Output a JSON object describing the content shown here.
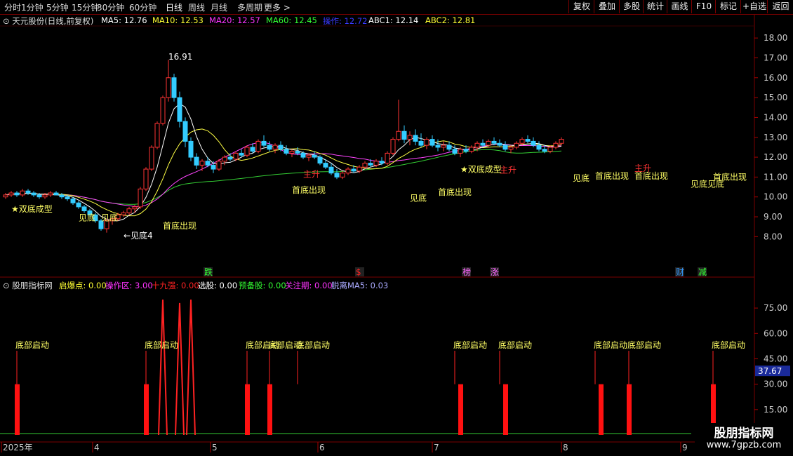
{
  "toolbar": {
    "periods": [
      "分时",
      "1分钟",
      "5分钟",
      "15分钟",
      "30分钟",
      "60分钟",
      "日线",
      "周线",
      "月线",
      "多周期",
      "更多 >"
    ],
    "active_period": "日线",
    "buttons": [
      "复权",
      "叠加",
      "多股",
      "统计",
      "画线",
      "F10",
      "标记",
      "+自选",
      "返回"
    ]
  },
  "main_header": {
    "stock_title": "天元股份(日线,前复权)",
    "indicators": [
      {
        "name": "MA5",
        "value": "12.76",
        "color": "#ffffff"
      },
      {
        "name": "MA10",
        "value": "12.53",
        "color": "#ffff33"
      },
      {
        "name": "MA20",
        "value": "12.57",
        "color": "#ff33ff"
      },
      {
        "name": "MA60",
        "value": "12.45",
        "color": "#33ff33"
      },
      {
        "name": "操作",
        "value": "12.72",
        "color": "#3a3aff"
      },
      {
        "name": "ABC1",
        "value": "12.14",
        "color": "#ffffff"
      },
      {
        "name": "ABC2",
        "value": "12.81",
        "color": "#ffff33"
      }
    ]
  },
  "sub_header": {
    "title": "股朋指标网",
    "indicators": [
      {
        "name": "启爆点",
        "value": "0.00",
        "color": "#ffff33"
      },
      {
        "name": "操作区",
        "value": "3.00",
        "color": "#ff33ff"
      },
      {
        "name": "十九强",
        "value": "0.00",
        "color": "#ff2222"
      },
      {
        "name": "选股",
        "value": "0.00",
        "color": "#ffffff"
      },
      {
        "name": "预备股",
        "value": "0.00",
        "color": "#33ff33"
      },
      {
        "name": "关注期",
        "value": "0.00",
        "color": "#ff33ff"
      },
      {
        "name": "脱离MA5",
        "value": "0.03",
        "color": "#aaaaff"
      }
    ]
  },
  "axis": {
    "price_ticks": [
      "18.00",
      "17.00",
      "16.00",
      "15.00",
      "14.00",
      "13.00",
      "12.00",
      "11.00",
      "10.00",
      "9.00",
      "8.00"
    ],
    "sub_ticks": [
      "75.00",
      "60.00",
      "45.00",
      "30.00",
      "15.00"
    ],
    "sub_current": "37.67",
    "x_labels": [
      "2025年",
      "4",
      "5",
      "6",
      "7",
      "8",
      "9"
    ],
    "price_range": [
      7.2,
      18.5
    ],
    "sub_range": [
      0,
      85
    ]
  },
  "chart_data": {
    "type": "candlestick",
    "series": [
      {
        "values": [
          [
            10.0,
            10.2,
            9.9,
            10.1
          ],
          [
            10.1,
            10.3,
            10.0,
            10.2
          ],
          [
            10.2,
            10.3,
            10.0,
            10.1
          ],
          [
            10.1,
            10.4,
            10.0,
            10.3
          ],
          [
            10.3,
            10.4,
            10.1,
            10.2
          ],
          [
            10.2,
            10.3,
            10.0,
            10.1
          ],
          [
            10.1,
            10.2,
            9.9,
            10.0
          ],
          [
            10.0,
            10.2,
            9.9,
            10.1
          ],
          [
            10.1,
            10.3,
            10.0,
            10.2
          ],
          [
            10.2,
            10.3,
            10.1,
            10.1
          ],
          [
            10.1,
            10.2,
            9.9,
            10.0
          ],
          [
            10.0,
            10.1,
            9.8,
            9.9
          ],
          [
            9.9,
            10.0,
            9.6,
            9.7
          ],
          [
            9.7,
            9.8,
            9.4,
            9.5
          ],
          [
            9.5,
            9.6,
            9.2,
            9.3
          ],
          [
            9.3,
            9.4,
            9.0,
            9.1
          ],
          [
            9.1,
            9.2,
            8.7,
            8.8
          ],
          [
            8.8,
            8.9,
            8.3,
            8.4
          ],
          [
            8.4,
            8.9,
            8.2,
            8.8
          ],
          [
            8.8,
            9.0,
            8.6,
            8.9
          ],
          [
            8.9,
            9.2,
            8.8,
            9.1
          ],
          [
            9.1,
            9.3,
            9.0,
            9.2
          ],
          [
            9.2,
            9.5,
            9.1,
            9.4
          ],
          [
            9.4,
            9.6,
            9.2,
            9.5
          ],
          [
            9.5,
            10.5,
            9.4,
            10.4
          ],
          [
            10.4,
            11.5,
            10.3,
            11.4
          ],
          [
            11.4,
            12.6,
            11.3,
            12.5
          ],
          [
            12.5,
            13.8,
            12.4,
            13.7
          ],
          [
            13.7,
            15.1,
            13.6,
            15.0
          ],
          [
            15.0,
            16.9,
            14.8,
            16.0
          ],
          [
            16.0,
            16.2,
            14.8,
            15.0
          ],
          [
            15.0,
            15.3,
            13.5,
            13.8
          ],
          [
            13.8,
            14.0,
            12.5,
            12.8
          ],
          [
            12.8,
            13.0,
            11.8,
            12.0
          ],
          [
            12.0,
            12.2,
            11.4,
            11.6
          ],
          [
            11.6,
            11.9,
            11.3,
            11.8
          ],
          [
            11.8,
            12.0,
            11.5,
            11.6
          ],
          [
            11.6,
            11.8,
            11.2,
            11.4
          ],
          [
            11.4,
            11.9,
            11.3,
            11.8
          ],
          [
            11.8,
            12.1,
            11.6,
            12.0
          ],
          [
            12.0,
            12.2,
            11.8,
            11.9
          ],
          [
            11.9,
            12.3,
            11.8,
            12.2
          ],
          [
            12.2,
            12.4,
            12.0,
            12.1
          ],
          [
            12.1,
            12.6,
            12.0,
            12.5
          ],
          [
            12.5,
            12.7,
            12.2,
            12.3
          ],
          [
            12.3,
            12.9,
            12.2,
            12.8
          ],
          [
            12.8,
            13.1,
            12.5,
            12.6
          ],
          [
            12.6,
            12.8,
            12.3,
            12.4
          ],
          [
            12.4,
            12.7,
            12.2,
            12.6
          ],
          [
            12.6,
            12.8,
            12.3,
            12.4
          ],
          [
            12.4,
            12.6,
            12.1,
            12.2
          ],
          [
            12.2,
            12.4,
            12.0,
            12.3
          ],
          [
            12.3,
            12.5,
            12.1,
            12.2
          ],
          [
            12.2,
            12.3,
            11.9,
            12.0
          ],
          [
            12.0,
            12.2,
            11.8,
            12.1
          ],
          [
            12.1,
            12.3,
            11.9,
            12.0
          ],
          [
            12.0,
            12.1,
            11.6,
            11.7
          ],
          [
            11.7,
            11.9,
            11.4,
            11.5
          ],
          [
            11.5,
            11.7,
            11.1,
            11.2
          ],
          [
            11.2,
            11.4,
            10.9,
            11.0
          ],
          [
            11.0,
            11.3,
            10.9,
            11.2
          ],
          [
            11.2,
            11.5,
            11.1,
            11.4
          ],
          [
            11.4,
            11.6,
            11.2,
            11.3
          ],
          [
            11.3,
            11.6,
            11.2,
            11.5
          ],
          [
            11.5,
            11.8,
            11.4,
            11.7
          ],
          [
            11.7,
            11.9,
            11.5,
            11.6
          ],
          [
            11.6,
            11.9,
            11.5,
            11.8
          ],
          [
            11.8,
            12.0,
            11.6,
            11.7
          ],
          [
            11.7,
            12.3,
            11.6,
            12.2
          ],
          [
            12.2,
            13.0,
            12.1,
            12.9
          ],
          [
            12.9,
            14.9,
            12.8,
            13.3
          ],
          [
            13.3,
            13.6,
            12.7,
            12.9
          ],
          [
            12.9,
            13.3,
            12.6,
            13.1
          ],
          [
            13.1,
            13.4,
            12.6,
            12.8
          ],
          [
            12.8,
            13.2,
            12.5,
            12.6
          ],
          [
            12.6,
            13.0,
            12.4,
            12.9
          ],
          [
            12.9,
            13.1,
            12.5,
            12.6
          ],
          [
            12.6,
            12.9,
            12.3,
            12.5
          ],
          [
            12.5,
            12.8,
            12.3,
            12.6
          ],
          [
            12.6,
            12.8,
            12.3,
            12.4
          ],
          [
            12.4,
            12.6,
            12.1,
            12.2
          ],
          [
            12.2,
            12.5,
            12.0,
            12.4
          ],
          [
            12.4,
            12.6,
            12.2,
            12.3
          ],
          [
            12.3,
            12.6,
            12.2,
            12.5
          ],
          [
            12.5,
            12.8,
            12.3,
            12.7
          ],
          [
            12.7,
            12.9,
            12.5,
            12.6
          ],
          [
            12.6,
            12.9,
            12.5,
            12.8
          ],
          [
            12.8,
            13.0,
            12.6,
            12.7
          ],
          [
            12.7,
            12.9,
            12.5,
            12.6
          ],
          [
            12.6,
            12.8,
            12.3,
            12.4
          ],
          [
            12.4,
            12.6,
            12.2,
            12.5
          ],
          [
            12.5,
            12.8,
            12.4,
            12.7
          ],
          [
            12.7,
            13.0,
            12.6,
            12.9
          ],
          [
            12.9,
            13.1,
            12.7,
            12.8
          ],
          [
            12.8,
            13.0,
            12.5,
            12.6
          ],
          [
            12.6,
            12.8,
            12.3,
            12.4
          ],
          [
            12.4,
            12.6,
            12.2,
            12.3
          ],
          [
            12.3,
            12.6,
            12.2,
            12.5
          ],
          [
            12.5,
            12.8,
            12.4,
            12.7
          ],
          [
            12.7,
            13.0,
            12.6,
            12.9
          ]
        ]
      }
    ],
    "annotations": [
      {
        "text": "16.91",
        "color": "#ffffff",
        "i": 29,
        "price": 16.91
      },
      {
        "text": "★双底成型",
        "color": "#ffff66",
        "i": 1,
        "price": 9.25
      },
      {
        "text": "见底",
        "color": "#ffff66",
        "i": 13,
        "price": 8.8
      },
      {
        "text": "见底",
        "color": "#ffff66",
        "i": 17,
        "price": 8.8
      },
      {
        "text": "←见底4",
        "color": "#ffffff",
        "i": 21,
        "price": 7.9
      },
      {
        "text": "首底出现",
        "color": "#ffff66",
        "i": 28,
        "price": 8.4
      },
      {
        "text": "主升",
        "color": "#ff3333",
        "i": 53,
        "price": 11.0
      },
      {
        "text": "首底出现",
        "color": "#ffff66",
        "i": 51,
        "price": 10.2
      },
      {
        "text": "见底",
        "color": "#ffff66",
        "i": 72,
        "price": 9.8
      },
      {
        "text": "首底出现",
        "color": "#ffff66",
        "i": 77,
        "price": 10.1
      },
      {
        "text": "★双底成型",
        "color": "#ffff66",
        "i": 81,
        "price": 11.25
      },
      {
        "text": "主升",
        "color": "#ff3333",
        "i": 88,
        "price": 11.2
      },
      {
        "text": "见底",
        "color": "#ffff66",
        "i": 101,
        "price": 10.8
      },
      {
        "text": "首底出现",
        "color": "#ffff66",
        "i": 105,
        "price": 10.9
      },
      {
        "text": "主升",
        "color": "#ff3333",
        "i": 112,
        "price": 11.3
      },
      {
        "text": "首底出现",
        "color": "#ffff66",
        "i": 112,
        "price": 10.9
      },
      {
        "text": "见底见底",
        "color": "#ffff66",
        "i": 122,
        "price": 10.5
      },
      {
        "text": "首底出现",
        "color": "#ffff66",
        "i": 126,
        "price": 10.85
      }
    ],
    "signals": [
      {
        "text": "跌",
        "color": "#33ff33",
        "i": 36
      },
      {
        "text": "$",
        "color": "#ff2222",
        "i": 63
      },
      {
        "text": "榜",
        "color": "#ff66ff",
        "i": 82
      },
      {
        "text": "涨",
        "color": "#ff66ff",
        "i": 87
      },
      {
        "text": "财",
        "color": "#3399ff",
        "i": 120
      },
      {
        "text": "减",
        "color": "#33ff33",
        "i": 124
      }
    ],
    "sub_labels": [
      {
        "text": "底部启动",
        "i": 2
      },
      {
        "text": "底部启动",
        "i": 25
      },
      {
        "text": "底部启动",
        "i": 43
      },
      {
        "text": "底部启动",
        "i": 47
      },
      {
        "text": "底部启动",
        "i": 52
      },
      {
        "text": "底部启动",
        "i": 80
      },
      {
        "text": "底部启动",
        "i": 88
      },
      {
        "text": "底部启动",
        "i": 105
      },
      {
        "text": "底部启动",
        "i": 111
      },
      {
        "text": "底部启动",
        "i": 126
      }
    ],
    "sub_bars": [
      {
        "i": 2,
        "value": 30
      },
      {
        "i": 25,
        "value": 30
      },
      {
        "i": 43,
        "value": 30
      },
      {
        "i": 47,
        "value": 30
      },
      {
        "i": 81,
        "value": 30
      },
      {
        "i": 89,
        "value": 30
      },
      {
        "i": 106,
        "value": 30
      },
      {
        "i": 111,
        "value": 30
      },
      {
        "i": 126,
        "value": 30
      }
    ],
    "sub_spikes": [
      {
        "i": 28,
        "value": 80
      },
      {
        "i": 31,
        "value": 78
      },
      {
        "i": 33,
        "value": 80
      }
    ]
  },
  "watermark": {
    "title": "股朋指标网",
    "url": "www.7gpzb.com"
  }
}
